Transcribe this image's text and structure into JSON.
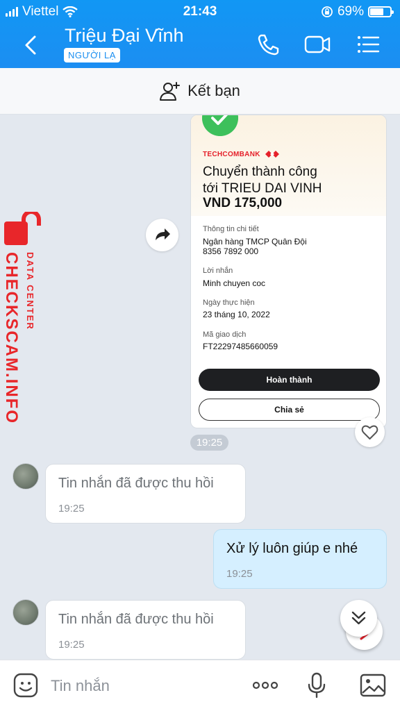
{
  "status": {
    "carrier": "Viettel",
    "time": "21:43",
    "battery": "69%",
    "battery_level": 0.69
  },
  "header": {
    "title": "Triệu Đại Vĩnh",
    "badge": "NGƯỜI LẠ"
  },
  "add_friend": {
    "label": "Kết bạn"
  },
  "receipt": {
    "brand": "TECHCOMBANK",
    "title_line1": "Chuyển thành công",
    "title_line2": "tới TRIEU DAI VINH",
    "amount": "VND 175,000",
    "details_label": "Thông tin chi tiết",
    "bank": "Ngân hàng TMCP Quân Đội",
    "account": "8356 7892 000",
    "message_label": "Lời nhắn",
    "message": "Minh chuyen coc",
    "date_label": "Ngày thực hiện",
    "date": "23 tháng 10, 2022",
    "txn_label": "Mã giao dịch",
    "txn": "FT22297485660059",
    "done_button": "Hoàn thành",
    "share_button": "Chia sẻ"
  },
  "receipt_time": "19:25",
  "messages": [
    {
      "text": "Tin nhắn đã được thu hồi",
      "time": "19:25",
      "direction": "in"
    },
    {
      "text": "Xử lý luôn giúp e nhé",
      "time": "19:25",
      "direction": "out"
    },
    {
      "text": "Tin nhắn đã được thu hồi",
      "time": "19:25",
      "direction": "in"
    }
  ],
  "watermark": {
    "main": "CHECKSCAM.INFO",
    "sub": "DATA CENTER"
  },
  "input": {
    "placeholder": "Tin nhắn"
  },
  "colors": {
    "header_blue": "#1a92f3",
    "outgoing_bubble": "#d5efff",
    "watermark_red": "#e8262a"
  }
}
